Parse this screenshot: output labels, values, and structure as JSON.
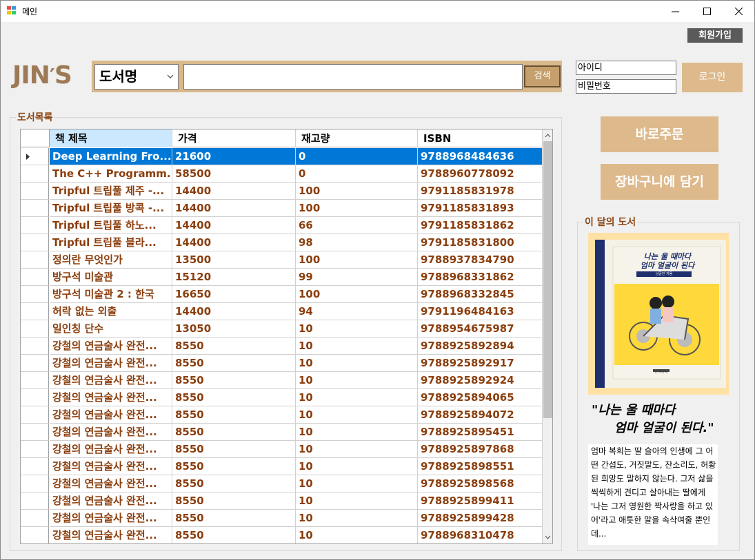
{
  "window": {
    "title": "메인",
    "minimize": "—",
    "maximize": "☐",
    "close": "✕"
  },
  "header": {
    "signup_label": "회원가입",
    "logo_main": "JIN",
    "logo_apos": "′",
    "logo_end": "S",
    "search_category": "도서명",
    "search_value": "",
    "search_button": "검색",
    "id_placeholder": "아이디",
    "pw_placeholder": "비밀번호",
    "login_button": "로그인"
  },
  "book_list": {
    "group_title": "도서목록",
    "columns": [
      "책 제목",
      "가격",
      "재고량",
      "ISBN"
    ],
    "rows": [
      {
        "title": "Deep Learning Fro...",
        "price": "21600",
        "stock": "0",
        "isbn": "9788968484636",
        "selected": true
      },
      {
        "title": "The C++ Programm...",
        "price": "58500",
        "stock": "0",
        "isbn": "9788960778092"
      },
      {
        "title": "Tripful 트립풀 제주 -...",
        "price": "14400",
        "stock": "100",
        "isbn": "9791185831978"
      },
      {
        "title": "Tripful 트립풀 방콕 -...",
        "price": "14400",
        "stock": "100",
        "isbn": "9791185831893"
      },
      {
        "title": "Tripful 트립풀 하노...",
        "price": "14400",
        "stock": "66",
        "isbn": "9791185831862"
      },
      {
        "title": "Tripful 트립풀 블라...",
        "price": "14400",
        "stock": "98",
        "isbn": "9791185831800"
      },
      {
        "title": "정의란 무엇인가",
        "price": "13500",
        "stock": "100",
        "isbn": "9788937834790"
      },
      {
        "title": "방구석 미술관",
        "price": "15120",
        "stock": "99",
        "isbn": "9788968331862"
      },
      {
        "title": "방구석 미술관 2 : 한국",
        "price": "16650",
        "stock": "100",
        "isbn": "9788968332845"
      },
      {
        "title": "허락 없는 외출",
        "price": "14400",
        "stock": "94",
        "isbn": "9791196484163"
      },
      {
        "title": "일인칭 단수",
        "price": "13050",
        "stock": "10",
        "isbn": "9788954675987"
      },
      {
        "title": "강철의 연금술사 완전...",
        "price": "8550",
        "stock": "10",
        "isbn": "9788925892894"
      },
      {
        "title": "강철의 연금술사 완전...",
        "price": "8550",
        "stock": "10",
        "isbn": "9788925892917"
      },
      {
        "title": "강철의 연금술사 완전...",
        "price": "8550",
        "stock": "10",
        "isbn": "9788925892924"
      },
      {
        "title": "강철의 연금술사 완전...",
        "price": "8550",
        "stock": "10",
        "isbn": "9788925894065"
      },
      {
        "title": "강철의 연금술사 완전...",
        "price": "8550",
        "stock": "10",
        "isbn": "9788925894072"
      },
      {
        "title": "강철의 연금술사 완전...",
        "price": "8550",
        "stock": "10",
        "isbn": "9788925895451"
      },
      {
        "title": "강철의 연금술사 완전...",
        "price": "8550",
        "stock": "10",
        "isbn": "9788925897868"
      },
      {
        "title": "강철의 연금술사 완전...",
        "price": "8550",
        "stock": "10",
        "isbn": "9788925898551"
      },
      {
        "title": "강철의 연금술사 완전...",
        "price": "8550",
        "stock": "10",
        "isbn": "9788925898568"
      },
      {
        "title": "강철의 연금술사 완전...",
        "price": "8550",
        "stock": "10",
        "isbn": "9788925899411"
      },
      {
        "title": "강철의 연금술사 완전...",
        "price": "8550",
        "stock": "10",
        "isbn": "9788925899428"
      },
      {
        "title": "강철의 연금술사 완전...",
        "price": "8550",
        "stock": "10",
        "isbn": "9788968310478"
      }
    ]
  },
  "actions": {
    "order_now": "바로주문",
    "add_to_cart": "장바구니에 담기"
  },
  "book_of_month": {
    "group_title": "이 달의 도서",
    "cover_title_line1": "나는 울 때마다",
    "cover_title_line2": "엄마 얼굴이 된다",
    "cover_author": "남궁인 지음",
    "cover_publisher": "문학동네",
    "quote_line1": "\"나는 울 때마다",
    "quote_line2": "엄마 얼굴이 된다.\"",
    "description": "엄마 복희는 딸 슬아의 인생에 그 어떤 간섭도, 거짓말도, 잔소리도, 허황된 희망도 말하지 않는다. 그저 삶을 씩씩하게 견디고 살아내는 딸에게 '나는 그저 영원한 짝사랑을 하고 있어'라고 애틋한 말을 속삭여줄 뿐인데..."
  },
  "colors": {
    "accent_tan": "#ddb98c",
    "logo_brown": "#9d7a55",
    "row_text": "#8b3e0d",
    "selection_blue": "#0078d7"
  }
}
